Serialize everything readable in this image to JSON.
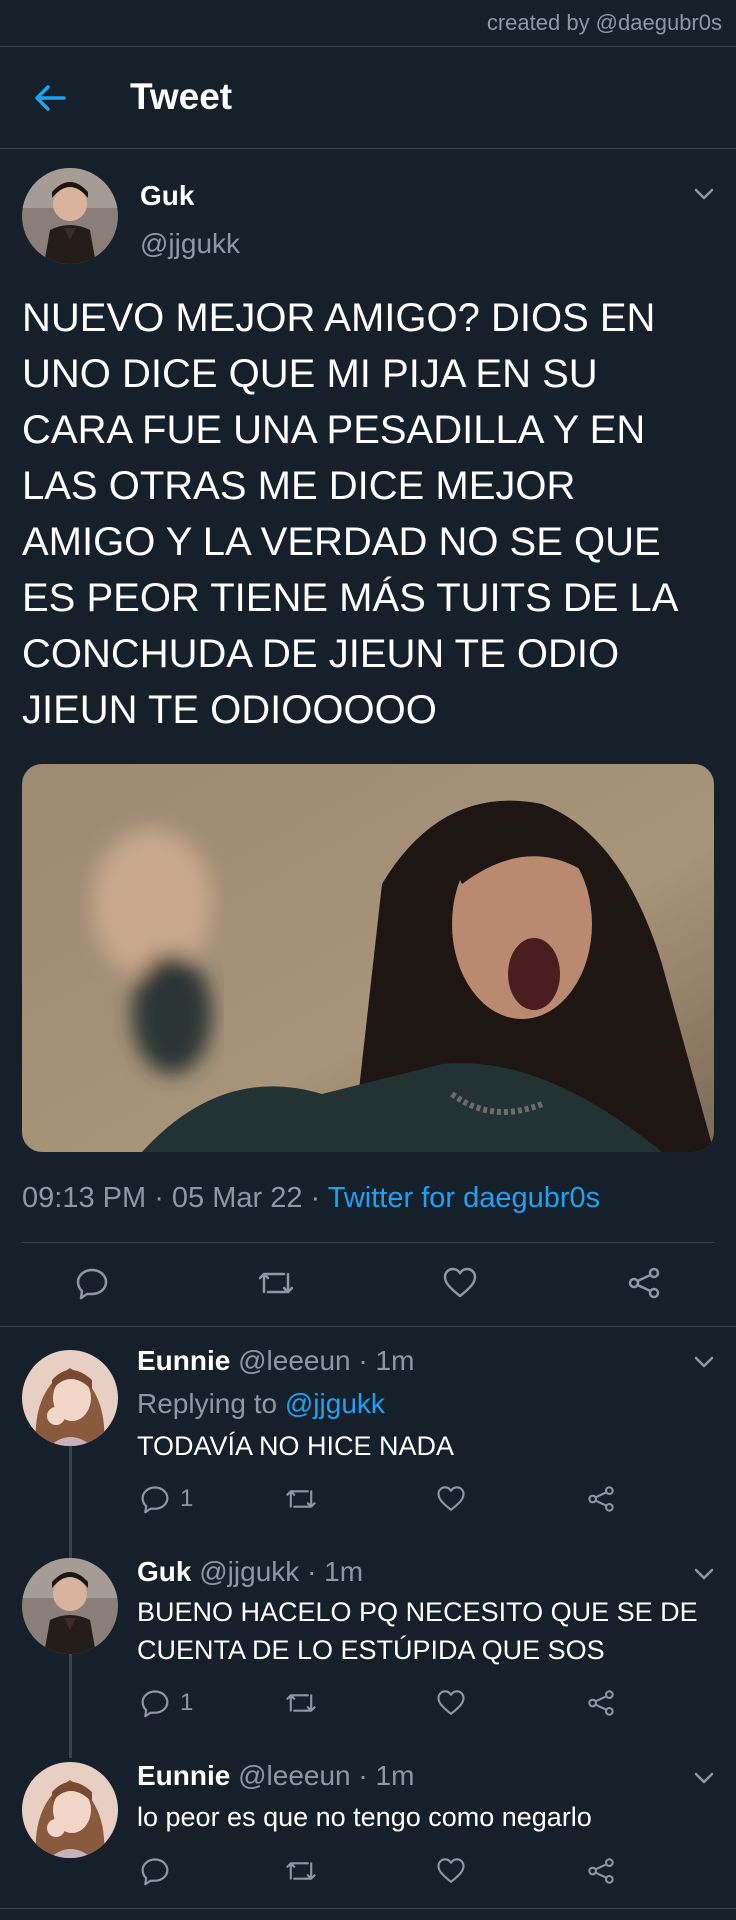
{
  "credit": "created by @daegubr0s",
  "header": {
    "title": "Tweet"
  },
  "main_tweet": {
    "name": "Guk",
    "handle": "@jjgukk",
    "text": "NUEVO MEJOR AMIGO? DIOS EN UNO DICE QUE MI PIJA EN SU CARA FUE UNA PESADILLA Y EN LAS OTRAS ME DICE MEJOR AMIGO Y LA VERDAD NO SE QUE ES PEOR TIENE MÁS TUITS DE LA CONCHUDA DE JIEUN TE ODIO JIEUN TE ODIOOOOO",
    "time": "09:13 PM",
    "date": "05 Mar 22",
    "sep": " · ",
    "source": "Twitter for daegubr0s"
  },
  "replies": [
    {
      "name": "Eunnie",
      "handle": "@leeeun",
      "time": "· 1m",
      "replying_label": "Replying to",
      "replying_to": "@jjgukk",
      "text": "TODAVÍA NO HICE NADA",
      "reply_count": "1"
    },
    {
      "name": "Guk",
      "handle": "@jjgukk",
      "time": "· 1m",
      "text": "BUENO HACELO PQ NECESITO QUE SE DE CUENTA DE LO ESTÚPIDA QUE SOS",
      "reply_count": "1"
    },
    {
      "name": "Eunnie",
      "handle": "@leeeun",
      "time": "· 1m",
      "text": "lo peor es que no tengo como negarlo",
      "reply_count": ""
    }
  ],
  "colors": {
    "background": "#15202b",
    "accent": "#1da1f2",
    "muted": "#8b98a5",
    "divider": "#38444d"
  },
  "icons": [
    "back-arrow-icon",
    "chevron-down-icon",
    "reply-icon",
    "retweet-icon",
    "like-icon",
    "share-icon"
  ]
}
